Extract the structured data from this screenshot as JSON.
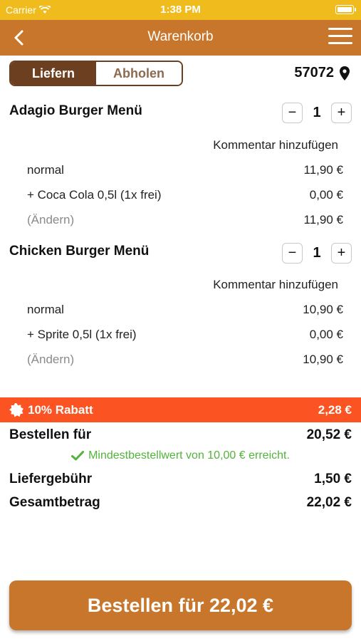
{
  "status": {
    "carrier": "Carrier",
    "time": "1:38 PM"
  },
  "nav": {
    "title": "Warenkorb"
  },
  "delivery": {
    "options": [
      "Liefern",
      "Abholen"
    ],
    "selected": "Liefern",
    "zip": "57072"
  },
  "items": [
    {
      "name": "Adagio Burger Menü",
      "qty": "1",
      "comment_label": "Kommentar hinzufügen",
      "lines": [
        {
          "label": "normal",
          "price": "11,90 €"
        },
        {
          "label": "+ Coca Cola 0,5l (1x frei)",
          "price": "0,00 €"
        },
        {
          "label": "(Ändern)",
          "price": "11,90 €"
        }
      ]
    },
    {
      "name": "Chicken Burger Menü",
      "qty": "1",
      "comment_label": "Kommentar hinzufügen",
      "lines": [
        {
          "label": "normal",
          "price": "10,90 €"
        },
        {
          "label": "+ Sprite 0,5l (1x frei)",
          "price": "0,00 €"
        },
        {
          "label": "(Ändern)",
          "price": "10,90 €"
        }
      ]
    }
  ],
  "discount": {
    "label": "10% Rabatt",
    "amount": "2,28 €"
  },
  "summary": {
    "order_for_label": "Bestellen für",
    "order_for_value": "20,52 €",
    "min_order_msg": "Mindestbestellwert von 10,00 € erreicht.",
    "delivery_fee_label": "Liefergebühr",
    "delivery_fee_value": "1,50 €",
    "total_label": "Gesamtbetrag",
    "total_value": "22,02 €"
  },
  "order_button": {
    "label": "Bestellen für 22,02 €"
  },
  "colors": {
    "status_bar": "#f0bb1c",
    "nav_bar": "#c8762b",
    "segment_active": "#6b3f1f",
    "discount_bar": "#fb5422",
    "success_green": "#53b33b",
    "order_button": "#c8762b"
  }
}
